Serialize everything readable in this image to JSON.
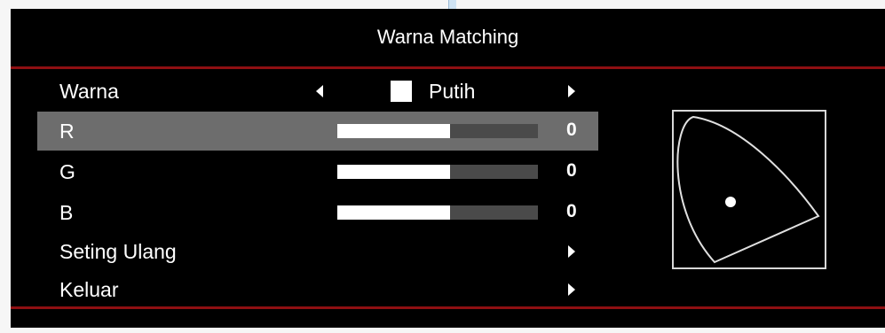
{
  "title": "Warna Matching",
  "colors": {
    "osd_background": "#000000",
    "accent_red": "#8e0f12",
    "selected_row": "#6d6d6d",
    "bar_track": "#4a4a4a",
    "bar_fill": "#ffffff",
    "swatch": "#ffffff"
  },
  "menu": {
    "warna": {
      "label": "Warna",
      "value": "Putih"
    },
    "r": {
      "label": "R",
      "value": "0",
      "fill_percent": 56
    },
    "g": {
      "label": "G",
      "value": "0",
      "fill_percent": 56
    },
    "b": {
      "label": "B",
      "value": "0",
      "fill_percent": 56
    },
    "reset": {
      "label": "Seting Ulang"
    },
    "exit": {
      "label": "Keluar"
    }
  },
  "icons": {
    "left_arrow": "left-triangle",
    "right_arrow": "right-triangle",
    "gamut": "color-gamut-diagram"
  }
}
